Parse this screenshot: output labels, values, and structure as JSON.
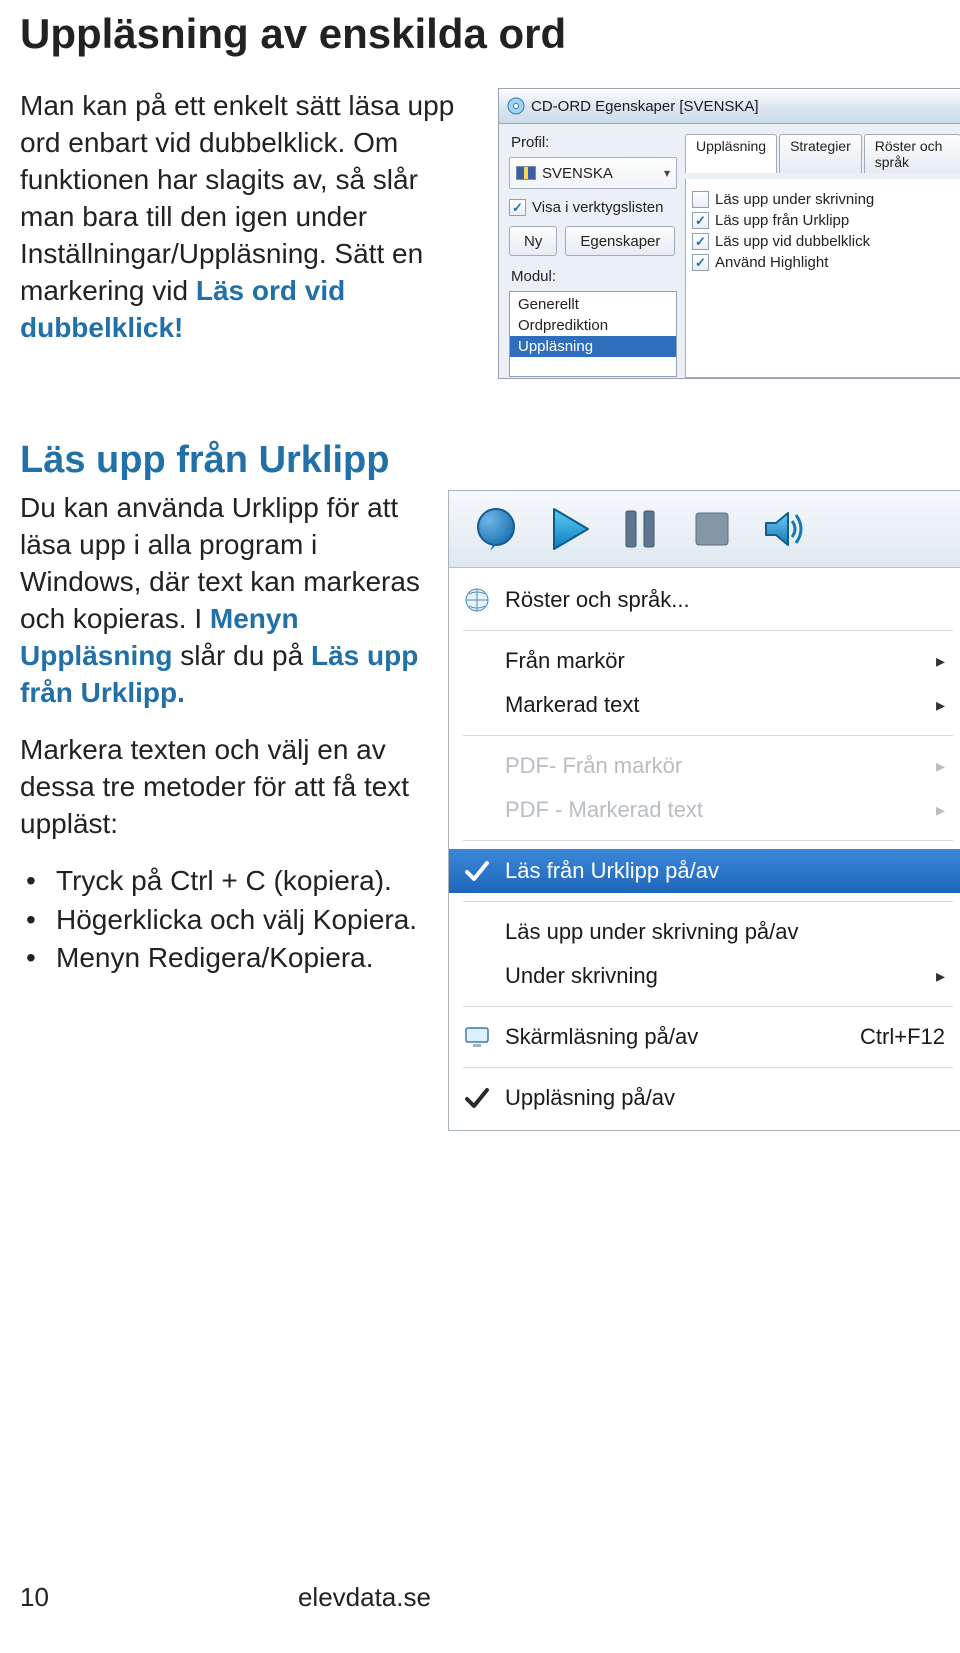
{
  "heading1": "Uppläsning av enskilda ord",
  "para1_a": "Man kan på ett enkelt sätt läsa upp ord enbart vid dubbelklick. Om funktionen har slagits av, så slår man bara till den igen under Inställningar/Uppläsning. Sätt en markering vid ",
  "para1_emph": "Läs ord vid dubbelklick!",
  "heading2": "Läs upp från Urklipp",
  "para2_a": "Du kan använda Urklipp för att läsa upp i alla program i Windows, där text kan markeras och kopieras. I ",
  "para2_emph1": "Menyn Uppläsning",
  "para2_b": " slår du på ",
  "para2_emph2": "Läs upp från Urklipp.",
  "para3": "Markera texten och välj en av dessa tre metoder för att få text uppläst:",
  "bullets": {
    "b1": "Tryck på Ctrl + C (kopiera).",
    "b2": "Högerklicka och välj Kopiera.",
    "b3": "Menyn Redigera/Kopiera."
  },
  "footer": {
    "page": "10",
    "site": "elevdata.se"
  },
  "dialog1": {
    "title": "CD-ORD Egenskaper [SVENSKA]",
    "profile_label": "Profil:",
    "profile_value": "SVENSKA",
    "visa_verktyg": "Visa i verktygslisten",
    "btn_ny": "Ny",
    "btn_egenskaper": "Egenskaper",
    "modul_label": "Modul:",
    "modul_items": {
      "g": "Generellt",
      "o": "Ordprediktion",
      "u": "Uppläsning"
    },
    "tabs": {
      "t1": "Uppläsning",
      "t2": "Strategier",
      "t3": "Röster och språk"
    },
    "cb1": "Läs upp under skrivning",
    "cb2": "Läs upp från Urklipp",
    "cb3": "Läs upp vid dubbelklick",
    "cb4": "Använd Highlight"
  },
  "menu2": {
    "roster": "Röster och språk...",
    "fran_markor": "Från markör",
    "markerad_text": "Markerad text",
    "pdf_fran_markor": "PDF- Från markör",
    "pdf_markerad_text": "PDF - Markerad text",
    "las_urklipp": "Läs från Urklipp på/av",
    "las_skrivning": "Läs upp under skrivning på/av",
    "under_skrivning": "Under skrivning",
    "skarm": "Skärmläsning på/av",
    "skarm_shortcut": "Ctrl+F12",
    "upplasning": "Uppläsning på/av"
  }
}
